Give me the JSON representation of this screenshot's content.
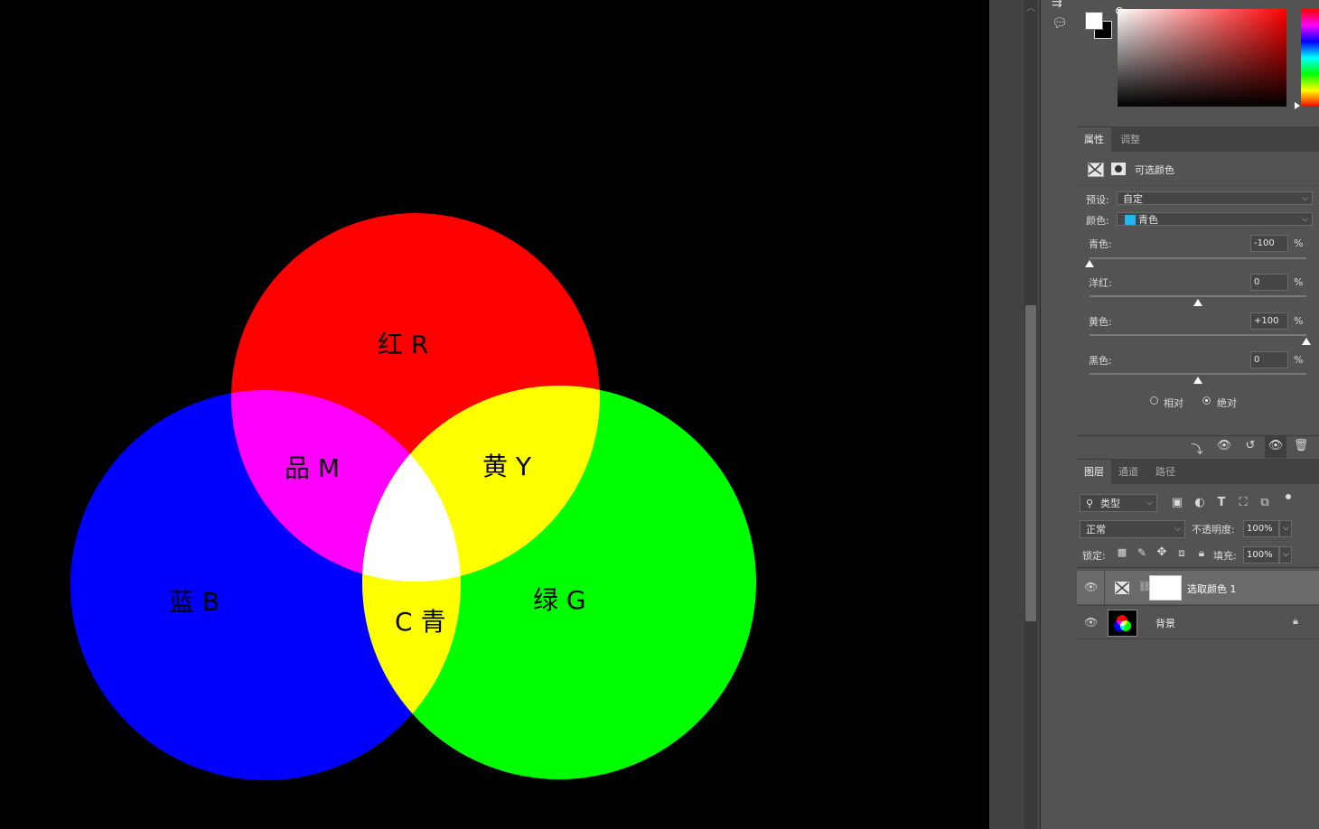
{
  "venn": {
    "labels": {
      "red": "红 R",
      "magenta": "品 M",
      "yellow": "黄 Y",
      "blue": "蓝 B",
      "cyan": "C 青",
      "green": "绿 G"
    },
    "colors": {
      "red": "#ff0000",
      "green": "#00ff00",
      "blue": "#0000ff",
      "magenta": "#ff00ff",
      "yellow": "#ffff00",
      "white": "#ffffff",
      "background": "#000000"
    }
  },
  "properties": {
    "tabs": [
      "属性",
      "调整"
    ],
    "adjustment_title": "可选颜色",
    "preset_label": "预设:",
    "preset_value": "自定",
    "color_label": "颜色:",
    "color_value": "青色",
    "color_swatch": "#22b6f0",
    "sliders": [
      {
        "label": "青色:",
        "value": "-100",
        "unit": "%",
        "level": -100
      },
      {
        "label": "洋红:",
        "value": "0",
        "unit": "%",
        "level": 0
      },
      {
        "label": "黄色:",
        "value": "+100",
        "unit": "%",
        "level": 100
      },
      {
        "label": "黑色:",
        "value": "0",
        "unit": "%",
        "level": 0
      }
    ],
    "method_relative": "相对",
    "method_absolute": "绝对"
  },
  "layers": {
    "tabs": [
      "图层",
      "通道",
      "路径"
    ],
    "filter_label": "类型",
    "blend_mode": "正常",
    "opacity_label": "不透明度:",
    "opacity_value": "100%",
    "lock_label": "锁定:",
    "fill_label": "填充:",
    "fill_value": "100%",
    "items": [
      {
        "name": "选取颜色 1"
      },
      {
        "name": "背景"
      }
    ]
  }
}
